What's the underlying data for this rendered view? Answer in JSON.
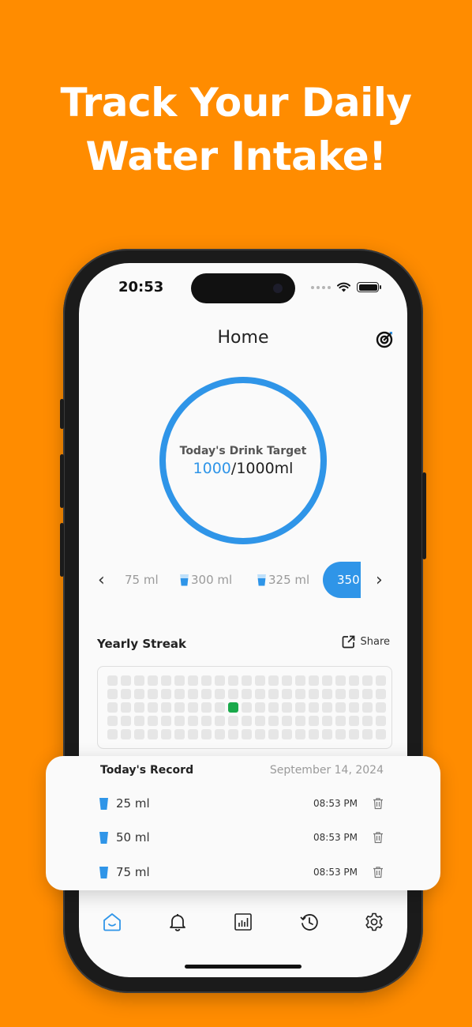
{
  "headline": [
    "Track Your Daily",
    "Water Intake!"
  ],
  "status_bar": {
    "time": "20:53"
  },
  "header": {
    "title": "Home"
  },
  "target": {
    "label": "Today's Drink Target",
    "current": "1000",
    "separator": "/",
    "goal": "1000ml",
    "progress": 1.0
  },
  "quick_add": {
    "items": [
      "75 ml",
      "300 ml",
      "325 ml"
    ],
    "selected": "350"
  },
  "streak": {
    "title": "Yearly Streak",
    "share_label": "Share",
    "rows": 5,
    "cols": 21,
    "active_cell": {
      "row": 2,
      "col": 9
    }
  },
  "record": {
    "title": "Today's Record",
    "date": "September 14, 2024",
    "entries": [
      {
        "amount": "25 ml",
        "time": "08:53 PM"
      },
      {
        "amount": "50 ml",
        "time": "08:53 PM"
      },
      {
        "amount": "75 ml",
        "time": "08:53 PM"
      }
    ]
  },
  "nav": [
    "home-icon",
    "bell-icon",
    "stats-icon",
    "history-icon",
    "settings-icon"
  ],
  "colors": {
    "background": "#FF8C00",
    "accent": "#2F95E8",
    "streak_active": "#19A94A"
  }
}
